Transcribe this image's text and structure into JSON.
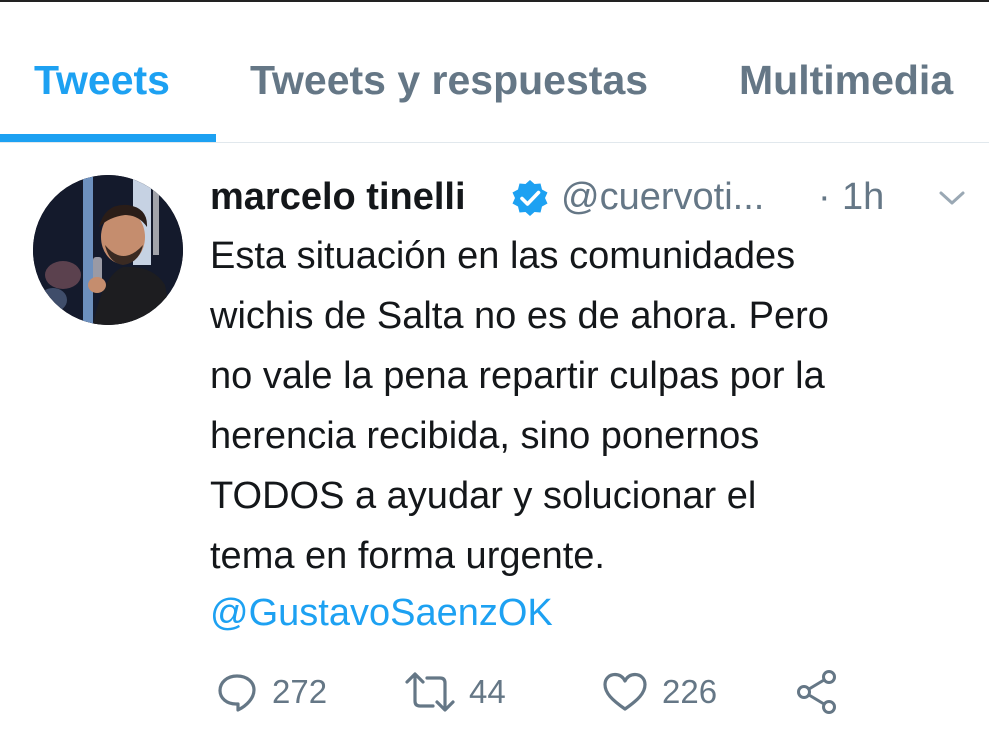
{
  "tabs": [
    {
      "label": "Tweets",
      "active": true
    },
    {
      "label": "Tweets y respuestas",
      "active": false
    },
    {
      "label": "Multimedia",
      "active": false
    }
  ],
  "tweet": {
    "author_name": "marcelo tinelli",
    "verified_icon": "verified-badge-icon",
    "handle": "@cuervoti...",
    "separator": "·",
    "time": "1h",
    "menu_icon": "chevron-down-icon",
    "text_lines": [
      "Esta situación en las comunidades",
      "wichis de Salta no es de ahora. Pero",
      "no vale la pena repartir culpas por la",
      "herencia recibida, sino ponernos",
      "TODOS a ayudar y solucionar el",
      "tema en forma urgente."
    ],
    "mention": "@GustavoSaenzOK",
    "actions": {
      "reply": {
        "icon": "reply-icon",
        "count": "272"
      },
      "retweet": {
        "icon": "retweet-icon",
        "count": "44"
      },
      "like": {
        "icon": "heart-icon",
        "count": "226"
      },
      "share": {
        "icon": "share-icon"
      }
    }
  },
  "colors": {
    "accent": "#1da1f2",
    "secondary_text": "#657786",
    "primary_text": "#14171a",
    "divider": "#e1e8ed"
  }
}
